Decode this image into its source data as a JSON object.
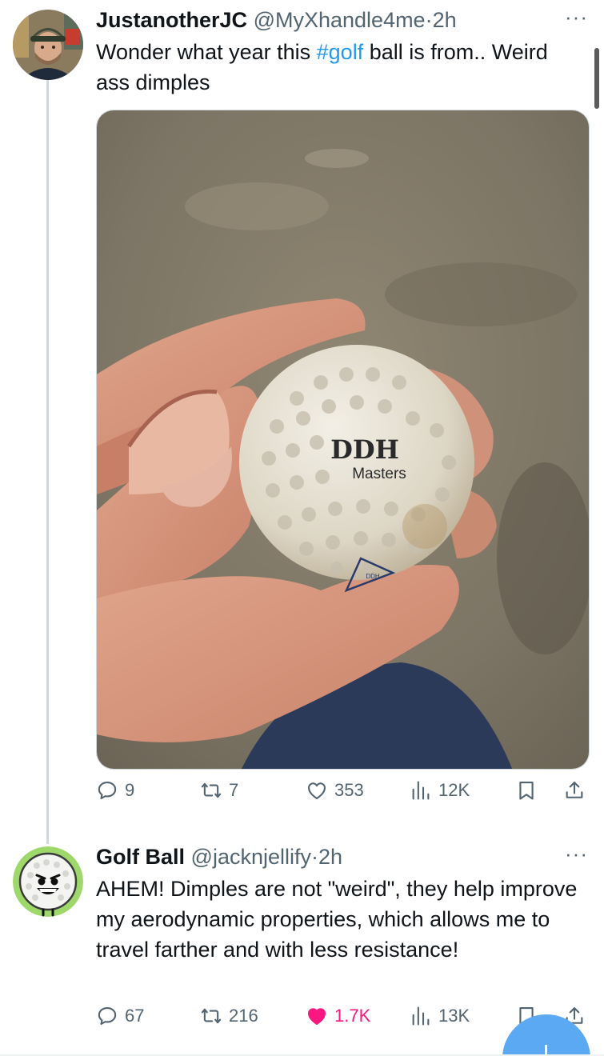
{
  "tweets": [
    {
      "author_name": "JustanotherJC",
      "handle": "@MyXhandle4me",
      "separator": "·",
      "time": "2h",
      "more": "···",
      "text_before": "Wonder what year this ",
      "hashtag": "#golf",
      "text_after": " ball is from.. Weird ass dimples",
      "media": {
        "ball_brand": "DDH",
        "ball_model": "Masters",
        "ball_logo": "DDH"
      },
      "stats": {
        "replies": "9",
        "reposts": "7",
        "likes": "353",
        "views": "12K"
      },
      "liked": false
    },
    {
      "author_name": "Golf Ball",
      "handle": "@jacknjellify",
      "separator": "·",
      "time": "2h",
      "more": "···",
      "text": "AHEM! Dimples are not \"weird\", they help improve my aerodynamic properties, which allows me to travel farther and with less resistance!",
      "stats": {
        "replies": "67",
        "reposts": "216",
        "likes": "1.7K",
        "views": "13K"
      },
      "liked": true
    }
  ],
  "icons": {
    "reply": "speech-bubble-icon",
    "repost": "repost-arrows-icon",
    "like": "heart-icon",
    "views": "bar-chart-icon",
    "bookmark": "bookmark-icon",
    "share": "share-upload-icon"
  },
  "colors": {
    "accent": "#1d9bf0",
    "like_active": "#f91880",
    "secondary_text": "#536471",
    "thread_line": "#cfd9de"
  }
}
